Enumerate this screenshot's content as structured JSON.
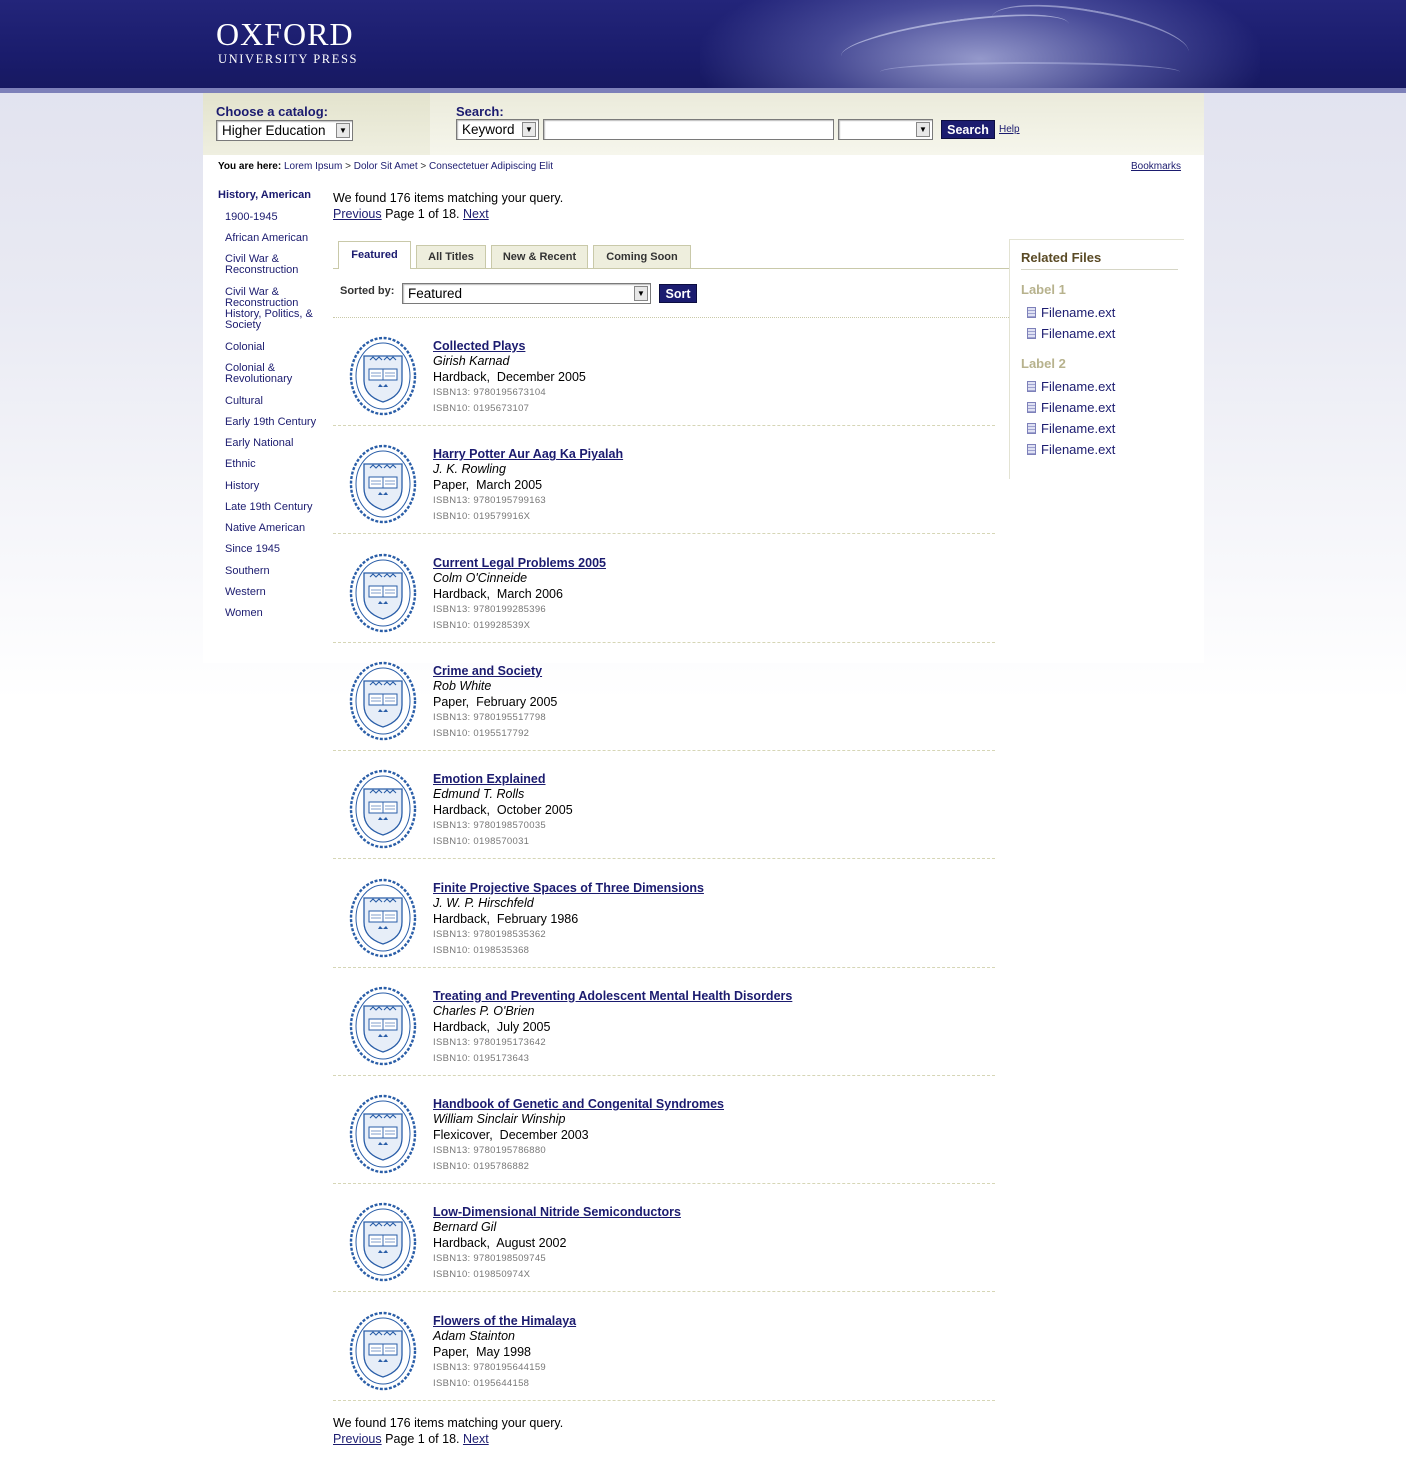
{
  "brand": {
    "name": "OXFORD",
    "subtitle": "UNIVERSITY PRESS"
  },
  "catalog": {
    "label": "Choose a catalog:",
    "selected": "Higher Education"
  },
  "search": {
    "label": "Search:",
    "field_selected": "Keyword",
    "query": "",
    "scope_selected": "",
    "button": "Search",
    "help": "Help"
  },
  "breadcrumb": {
    "prefix": "You are here:",
    "items": [
      "Lorem Ipsum",
      "Dolor Sit Amet",
      "Consectetuer Adipiscing Elit"
    ],
    "separator": ">"
  },
  "bookmarks": "Bookmarks",
  "sidebar": {
    "title": "History, American",
    "items": [
      "1900-1945",
      "African American",
      "Civil War & Reconstruction",
      "Civil War & Reconstruction History, Politics, & Society",
      "Colonial",
      "Colonial & Revolutionary",
      "Cultural",
      "Early 19th Century",
      "Early National",
      "Ethnic",
      "History",
      "Late 19th Century",
      "Native American",
      "Since 1945",
      "Southern",
      "Western",
      "Women"
    ]
  },
  "results_info": {
    "found": "We found 176 items matching your query.",
    "previous": "Previous",
    "page": "Page 1 of 18.",
    "next": "Next"
  },
  "tabs": [
    "Featured",
    "All Titles",
    "New & Recent",
    "Coming Soon"
  ],
  "active_tab": "Featured",
  "sort": {
    "label": "Sorted by:",
    "selected": "Featured",
    "button": "Sort"
  },
  "results": [
    {
      "title": "Collected Plays",
      "author": "Girish Karnad",
      "format": "Hardback,  December 2005",
      "isbn13": "ISBN13: 9780195673104",
      "isbn10": "ISBN10: 0195673107"
    },
    {
      "title": "Harry Potter Aur Aag Ka Piyalah",
      "author": "J. K. Rowling",
      "format": "Paper,  March 2005",
      "isbn13": "ISBN13: 9780195799163",
      "isbn10": "ISBN10: 019579916X"
    },
    {
      "title": "Current Legal Problems 2005",
      "author": "Colm O'Cinneide",
      "format": "Hardback,  March 2006",
      "isbn13": "ISBN13: 9780199285396",
      "isbn10": "ISBN10: 019928539X"
    },
    {
      "title": "Crime and Society",
      "author": "Rob White",
      "format": "Paper,  February 2005",
      "isbn13": "ISBN13: 9780195517798",
      "isbn10": "ISBN10: 0195517792"
    },
    {
      "title": "Emotion Explained",
      "author": "Edmund T. Rolls",
      "format": "Hardback,  October 2005",
      "isbn13": "ISBN13: 9780198570035",
      "isbn10": "ISBN10: 0198570031"
    },
    {
      "title": "Finite Projective Spaces of Three Dimensions",
      "author": "J. W. P. Hirschfeld",
      "format": "Hardback,  February 1986",
      "isbn13": "ISBN13: 9780198535362",
      "isbn10": "ISBN10: 0198535368"
    },
    {
      "title": "Treating and Preventing Adolescent Mental Health Disorders",
      "author": "Charles P. O'Brien",
      "format": "Hardback,  July 2005",
      "isbn13": "ISBN13: 9780195173642",
      "isbn10": "ISBN10: 0195173643"
    },
    {
      "title": "Handbook of Genetic and Congenital Syndromes",
      "author": "William Sinclair Winship",
      "format": "Flexicover,  December 2003",
      "isbn13": "ISBN13: 9780195786880",
      "isbn10": "ISBN10: 0195786882"
    },
    {
      "title": "Low-Dimensional Nitride Semiconductors",
      "author": "Bernard Gil",
      "format": "Hardback,  August 2002",
      "isbn13": "ISBN13: 9780198509745",
      "isbn10": "ISBN10: 019850974X"
    },
    {
      "title": "Flowers of the Himalaya",
      "author": "Adam Stainton",
      "format": "Paper,  May 1998",
      "isbn13": "ISBN13: 9780195644159",
      "isbn10": "ISBN10: 0195644158"
    }
  ],
  "related": {
    "title": "Related Files",
    "groups": [
      {
        "label": "Label 1",
        "files": [
          "Filename.ext",
          "Filename.ext"
        ]
      },
      {
        "label": "Label 2",
        "files": [
          "Filename.ext",
          "Filename.ext",
          "Filename.ext",
          "Filename.ext"
        ]
      }
    ]
  },
  "colors": {
    "brand_navy": "#1b1c6f",
    "link": "#1b1b6f",
    "label_tan": "#b7b28d"
  },
  "icons": {
    "cover": "oxford-crest-icon",
    "file": "document-icon",
    "dropdown": "dropdown-arrow-icon"
  }
}
